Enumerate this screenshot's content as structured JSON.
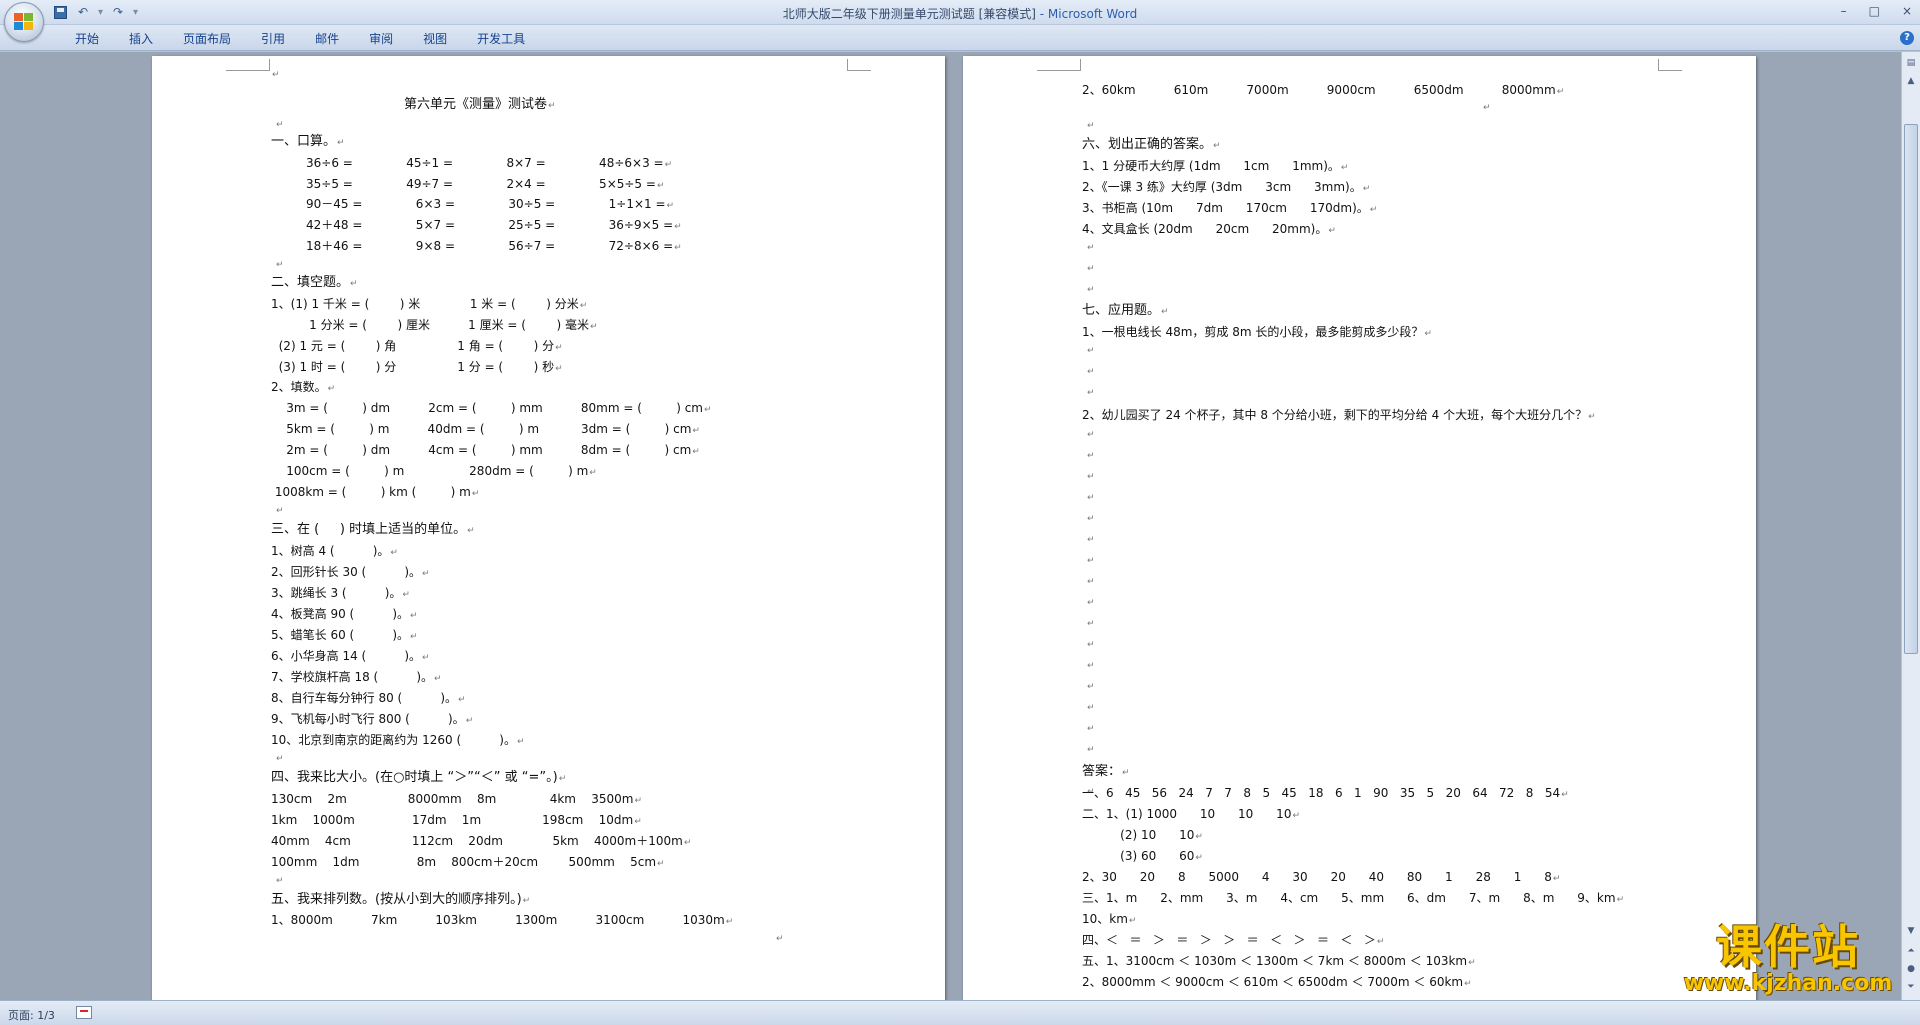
{
  "window": {
    "title": "北师大版二年级下册测量单元测试题 [兼容模式]",
    "title_app": " - Microsoft Word",
    "controls": [
      "–",
      "□",
      "×"
    ]
  },
  "ribbon": {
    "tabs": [
      "开始",
      "插入",
      "页面布局",
      "引用",
      "邮件",
      "审阅",
      "视图",
      "开发工具"
    ],
    "help": "?"
  },
  "status": {
    "page": "页面: 1/3"
  },
  "watermark": {
    "brand": "课件站",
    "url": "www.kjzhan.com"
  },
  "pilcrow": "↵",
  "left_page": {
    "title": "第六单元《测量》测试卷",
    "s1_head": "一、口算。",
    "s1_rows": [
      "36÷6 =              45÷1 =              8×7 =              48÷6×3 =",
      "35÷5 =              49÷7 =              2×4 =              5×5÷5 =",
      "90－45 =              6×3 =              30÷5 =              1÷1×1 =",
      "42＋48 =              5×7 =              25÷5 =              36÷9×5 =",
      "18＋46 =              9×8 =              56÷7 =              72÷8×6 ="
    ],
    "s2_head": "二、填空题。",
    "s2_lines": [
      "1、(1) 1 千米 = (        ) 米             1 米 = (        ) 分米",
      "          1 分米 = (        ) 厘米          1 厘米 = (        ) 毫米",
      "  (2) 1 元 = (        ) 角                1 角 = (        ) 分",
      "  (3) 1 时 = (        ) 分                1 分 = (        ) 秒",
      "2、填数。"
    ],
    "s2_units": [
      "    3m = (         ) dm          2cm = (         ) mm          80mm = (         ) cm",
      "    5km = (         ) m          40dm = (         ) m           3dm = (         ) cm",
      "    2m = (         ) dm          4cm = (         ) mm          8dm = (         ) cm",
      "    100cm = (         ) m                 280dm = (         ) m",
      " 1008km = (         ) km (         ) m"
    ],
    "s3_head": "三、在 (     ) 时填上适当的单位。",
    "s3_items": [
      "1、树高 4 (          )。",
      "2、回形针长 30 (          )。",
      "3、跳绳长 3 (          )。",
      "4、板凳高 90 (          )。",
      "5、蜡笔长 60 (          )。",
      "6、小华身高 14 (          )。",
      "7、学校旗杆高 18 (          )。",
      "8、自行车每分钟行 80 (          )。",
      "9、飞机每小时飞行 800 (          )。",
      "10、北京到南京的距离约为 1260 (          )。"
    ],
    "s4_head": "四、我来比大小。(在○时填上 “＞”“＜” 或 “=”。)",
    "s4_rows": [
      "130cm    2m                8000mm    8m              4km    3500m",
      "1km    1000m               17dm    1m                198cm    10dm",
      "40mm    4cm                112cm    20dm             5km    4000m＋100m",
      "100mm    1dm               8m    800cm＋20cm        500mm    5cm"
    ],
    "s5_head": "五、我来排列数。(按从小到大的顺序排列。)",
    "s5_row": "1、8000m          7km          103km          1300m          3100cm          1030m"
  },
  "right_page": {
    "r5_row2": "2、60km          610m          7000m          9000cm          6500dm          8000mm",
    "s6_head": "六、划出正确的答案。",
    "s6_items": [
      "1、1 分硬币大约厚 (1dm      1cm      1mm)。",
      "2、《一课 3 练》大约厚 (3dm      3cm      3mm)。",
      "3、书柜高 (10m      7dm      170cm      170dm)。",
      "4、文具盒长 (20dm      20cm      20mm)。"
    ],
    "s7_head": "七、应用题。",
    "s7_q1": "1、一根电线长 48m，剪成 8m 长的小段，最多能剪成多少段？",
    "s7_q2": "2、幼儿园买了 24 个杯子，其中 8 个分给小班，剩下的平均分给 4 个大班，每个大班分几个？",
    "ans_head": "答案：",
    "answers": [
      "一、6   45   56   24   7   7   8   5   45   18   6   1   90   35   5   20   64   72   8   54",
      "二、1、(1) 1000      10      10      10",
      "          (2) 10      10",
      "          (3) 60      60",
      "2、30      20      8      5000      4      30      20      40      80      1      28      1      8",
      "三、1、m      2、mm      3、m      4、cm      5、mm      6、dm      7、m      8、m      9、km",
      "10、km",
      "四、＜   ＝   ＞   ＝   ＞   ＞   ＝   ＜   ＞   ＝   ＜   ＞",
      "五、1、3100cm ＜ 1030m ＜ 1300m ＜ 7km ＜ 8000m ＜ 103km",
      "2、8000mm ＜ 9000cm ＜ 610m ＜ 6500dm ＜ 7000m ＜ 60km"
    ]
  }
}
